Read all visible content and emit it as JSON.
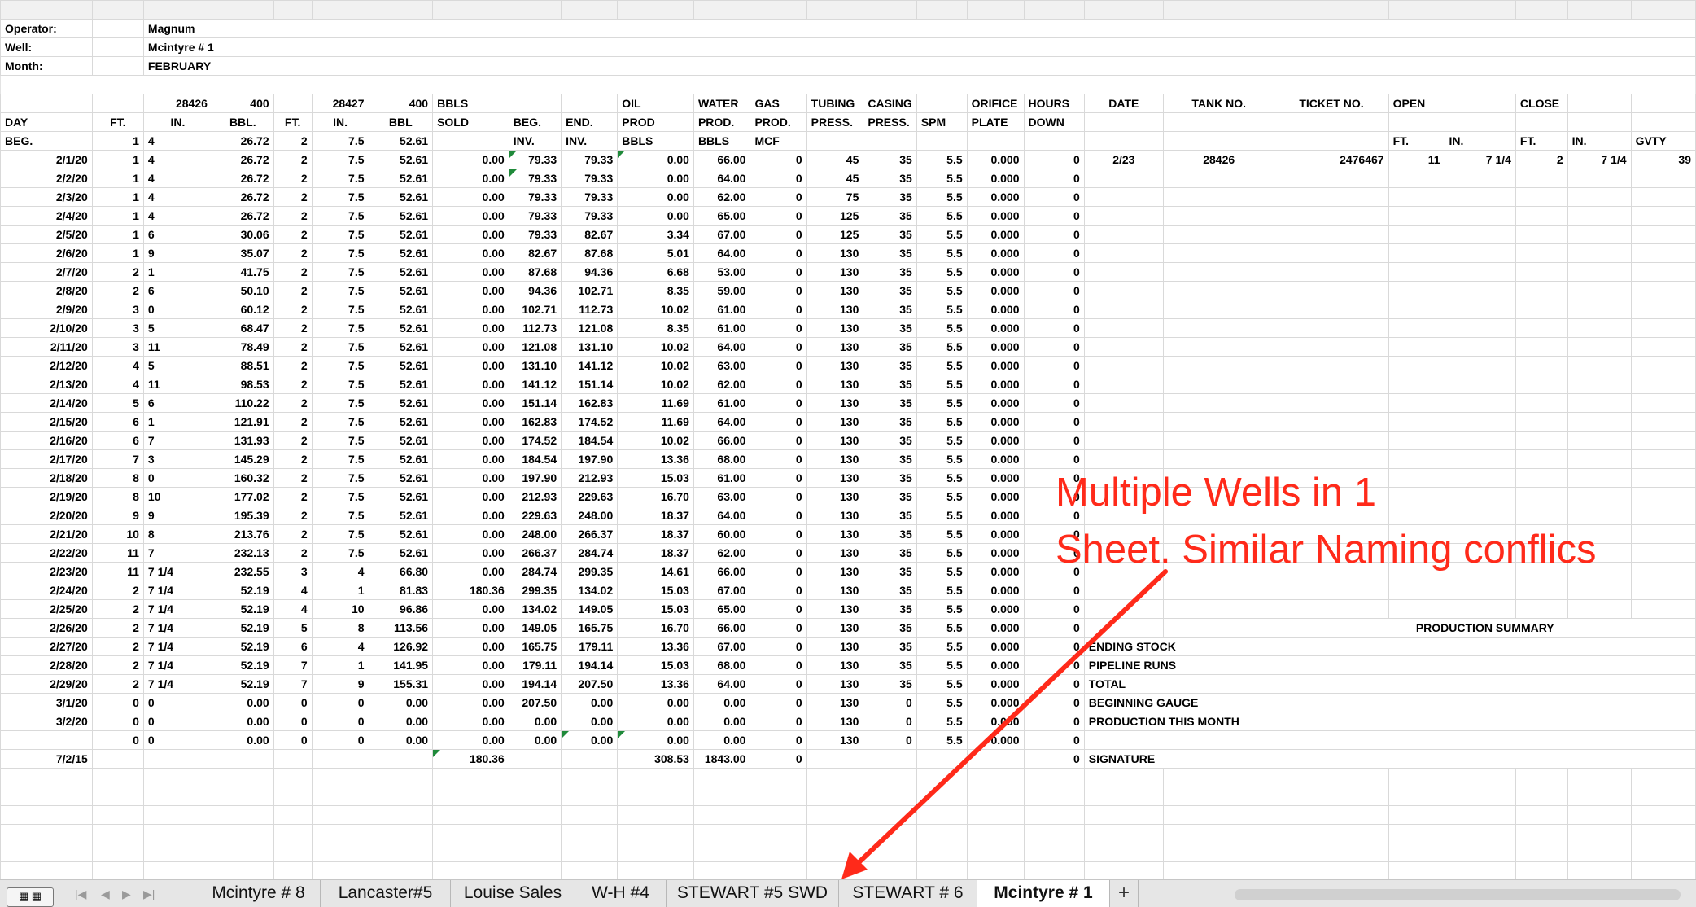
{
  "header": {
    "operator_label": "Operator:",
    "operator": "Magnum",
    "well_label": "Well:",
    "well": "Mcintyre # 1",
    "month_label": "Month:",
    "month": "FEBRUARY"
  },
  "headers": {
    "tank1_no": "28426",
    "tank1_cap": "400",
    "tank2_no": "28427",
    "tank2_cap": "400",
    "bbls": "BBLS",
    "sold": "SOLD",
    "oil": "OIL",
    "prod": "PROD",
    "water": "WATER",
    "prod_dot": "PROD.",
    "gas": "GAS",
    "tubing": "TUBING",
    "casing": "CASING",
    "orifice": "ORIFICE",
    "hours": "HOURS",
    "date": "DATE",
    "tank_no": "TANK NO.",
    "ticket_no": "TICKET NO.",
    "open": "OPEN",
    "close": "CLOSE",
    "day": "DAY",
    "ft": "FT.",
    "in": "IN.",
    "bbl": "BBL.",
    "bbl2": "BBL",
    "beg_dot": "BEG.",
    "end_dot": "END.",
    "press": "PRESS.",
    "spm": "SPM",
    "plate": "PLATE",
    "down": "DOWN",
    "beg": "BEG.",
    "inv": "INV.",
    "bbls_row": "BBLS",
    "mcf": "MCF",
    "gvty": "GVTY"
  },
  "daily_rows": [
    {
      "day": "2/1/20",
      "ft1": "1",
      "in1": "4",
      "bbl1": "26.72",
      "ft2": "2",
      "in2": "7.5",
      "bbl2": "52.61",
      "sold": "0.00",
      "beg_inv": "79.33",
      "end_inv": "79.33",
      "oil": "0.00",
      "water": "66.00",
      "gas": "0",
      "tubing": "45",
      "casing": "35",
      "spm": "5.5",
      "orifice": "0.000",
      "hours": "0"
    },
    {
      "day": "2/2/20",
      "ft1": "1",
      "in1": "4",
      "bbl1": "26.72",
      "ft2": "2",
      "in2": "7.5",
      "bbl2": "52.61",
      "sold": "0.00",
      "beg_inv": "79.33",
      "end_inv": "79.33",
      "oil": "0.00",
      "water": "64.00",
      "gas": "0",
      "tubing": "45",
      "casing": "35",
      "spm": "5.5",
      "orifice": "0.000",
      "hours": "0"
    },
    {
      "day": "2/3/20",
      "ft1": "1",
      "in1": "4",
      "bbl1": "26.72",
      "ft2": "2",
      "in2": "7.5",
      "bbl2": "52.61",
      "sold": "0.00",
      "beg_inv": "79.33",
      "end_inv": "79.33",
      "oil": "0.00",
      "water": "62.00",
      "gas": "0",
      "tubing": "75",
      "casing": "35",
      "spm": "5.5",
      "orifice": "0.000",
      "hours": "0"
    },
    {
      "day": "2/4/20",
      "ft1": "1",
      "in1": "4",
      "bbl1": "26.72",
      "ft2": "2",
      "in2": "7.5",
      "bbl2": "52.61",
      "sold": "0.00",
      "beg_inv": "79.33",
      "end_inv": "79.33",
      "oil": "0.00",
      "water": "65.00",
      "gas": "0",
      "tubing": "125",
      "casing": "35",
      "spm": "5.5",
      "orifice": "0.000",
      "hours": "0"
    },
    {
      "day": "2/5/20",
      "ft1": "1",
      "in1": "6",
      "bbl1": "30.06",
      "ft2": "2",
      "in2": "7.5",
      "bbl2": "52.61",
      "sold": "0.00",
      "beg_inv": "79.33",
      "end_inv": "82.67",
      "oil": "3.34",
      "water": "67.00",
      "gas": "0",
      "tubing": "125",
      "casing": "35",
      "spm": "5.5",
      "orifice": "0.000",
      "hours": "0"
    },
    {
      "day": "2/6/20",
      "ft1": "1",
      "in1": "9",
      "bbl1": "35.07",
      "ft2": "2",
      "in2": "7.5",
      "bbl2": "52.61",
      "sold": "0.00",
      "beg_inv": "82.67",
      "end_inv": "87.68",
      "oil": "5.01",
      "water": "64.00",
      "gas": "0",
      "tubing": "130",
      "casing": "35",
      "spm": "5.5",
      "orifice": "0.000",
      "hours": "0"
    },
    {
      "day": "2/7/20",
      "ft1": "2",
      "in1": "1",
      "bbl1": "41.75",
      "ft2": "2",
      "in2": "7.5",
      "bbl2": "52.61",
      "sold": "0.00",
      "beg_inv": "87.68",
      "end_inv": "94.36",
      "oil": "6.68",
      "water": "53.00",
      "gas": "0",
      "tubing": "130",
      "casing": "35",
      "spm": "5.5",
      "orifice": "0.000",
      "hours": "0"
    },
    {
      "day": "2/8/20",
      "ft1": "2",
      "in1": "6",
      "bbl1": "50.10",
      "ft2": "2",
      "in2": "7.5",
      "bbl2": "52.61",
      "sold": "0.00",
      "beg_inv": "94.36",
      "end_inv": "102.71",
      "oil": "8.35",
      "water": "59.00",
      "gas": "0",
      "tubing": "130",
      "casing": "35",
      "spm": "5.5",
      "orifice": "0.000",
      "hours": "0"
    },
    {
      "day": "2/9/20",
      "ft1": "3",
      "in1": "0",
      "bbl1": "60.12",
      "ft2": "2",
      "in2": "7.5",
      "bbl2": "52.61",
      "sold": "0.00",
      "beg_inv": "102.71",
      "end_inv": "112.73",
      "oil": "10.02",
      "water": "61.00",
      "gas": "0",
      "tubing": "130",
      "casing": "35",
      "spm": "5.5",
      "orifice": "0.000",
      "hours": "0"
    },
    {
      "day": "2/10/20",
      "ft1": "3",
      "in1": "5",
      "bbl1": "68.47",
      "ft2": "2",
      "in2": "7.5",
      "bbl2": "52.61",
      "sold": "0.00",
      "beg_inv": "112.73",
      "end_inv": "121.08",
      "oil": "8.35",
      "water": "61.00",
      "gas": "0",
      "tubing": "130",
      "casing": "35",
      "spm": "5.5",
      "orifice": "0.000",
      "hours": "0"
    },
    {
      "day": "2/11/20",
      "ft1": "3",
      "in1": "11",
      "bbl1": "78.49",
      "ft2": "2",
      "in2": "7.5",
      "bbl2": "52.61",
      "sold": "0.00",
      "beg_inv": "121.08",
      "end_inv": "131.10",
      "oil": "10.02",
      "water": "64.00",
      "gas": "0",
      "tubing": "130",
      "casing": "35",
      "spm": "5.5",
      "orifice": "0.000",
      "hours": "0"
    },
    {
      "day": "2/12/20",
      "ft1": "4",
      "in1": "5",
      "bbl1": "88.51",
      "ft2": "2",
      "in2": "7.5",
      "bbl2": "52.61",
      "sold": "0.00",
      "beg_inv": "131.10",
      "end_inv": "141.12",
      "oil": "10.02",
      "water": "63.00",
      "gas": "0",
      "tubing": "130",
      "casing": "35",
      "spm": "5.5",
      "orifice": "0.000",
      "hours": "0"
    },
    {
      "day": "2/13/20",
      "ft1": "4",
      "in1": "11",
      "bbl1": "98.53",
      "ft2": "2",
      "in2": "7.5",
      "bbl2": "52.61",
      "sold": "0.00",
      "beg_inv": "141.12",
      "end_inv": "151.14",
      "oil": "10.02",
      "water": "62.00",
      "gas": "0",
      "tubing": "130",
      "casing": "35",
      "spm": "5.5",
      "orifice": "0.000",
      "hours": "0"
    },
    {
      "day": "2/14/20",
      "ft1": "5",
      "in1": "6",
      "bbl1": "110.22",
      "ft2": "2",
      "in2": "7.5",
      "bbl2": "52.61",
      "sold": "0.00",
      "beg_inv": "151.14",
      "end_inv": "162.83",
      "oil": "11.69",
      "water": "61.00",
      "gas": "0",
      "tubing": "130",
      "casing": "35",
      "spm": "5.5",
      "orifice": "0.000",
      "hours": "0"
    },
    {
      "day": "2/15/20",
      "ft1": "6",
      "in1": "1",
      "bbl1": "121.91",
      "ft2": "2",
      "in2": "7.5",
      "bbl2": "52.61",
      "sold": "0.00",
      "beg_inv": "162.83",
      "end_inv": "174.52",
      "oil": "11.69",
      "water": "64.00",
      "gas": "0",
      "tubing": "130",
      "casing": "35",
      "spm": "5.5",
      "orifice": "0.000",
      "hours": "0"
    },
    {
      "day": "2/16/20",
      "ft1": "6",
      "in1": "7",
      "bbl1": "131.93",
      "ft2": "2",
      "in2": "7.5",
      "bbl2": "52.61",
      "sold": "0.00",
      "beg_inv": "174.52",
      "end_inv": "184.54",
      "oil": "10.02",
      "water": "66.00",
      "gas": "0",
      "tubing": "130",
      "casing": "35",
      "spm": "5.5",
      "orifice": "0.000",
      "hours": "0"
    },
    {
      "day": "2/17/20",
      "ft1": "7",
      "in1": "3",
      "bbl1": "145.29",
      "ft2": "2",
      "in2": "7.5",
      "bbl2": "52.61",
      "sold": "0.00",
      "beg_inv": "184.54",
      "end_inv": "197.90",
      "oil": "13.36",
      "water": "68.00",
      "gas": "0",
      "tubing": "130",
      "casing": "35",
      "spm": "5.5",
      "orifice": "0.000",
      "hours": "0"
    },
    {
      "day": "2/18/20",
      "ft1": "8",
      "in1": "0",
      "bbl1": "160.32",
      "ft2": "2",
      "in2": "7.5",
      "bbl2": "52.61",
      "sold": "0.00",
      "beg_inv": "197.90",
      "end_inv": "212.93",
      "oil": "15.03",
      "water": "61.00",
      "gas": "0",
      "tubing": "130",
      "casing": "35",
      "spm": "5.5",
      "orifice": "0.000",
      "hours": "0"
    },
    {
      "day": "2/19/20",
      "ft1": "8",
      "in1": "10",
      "bbl1": "177.02",
      "ft2": "2",
      "in2": "7.5",
      "bbl2": "52.61",
      "sold": "0.00",
      "beg_inv": "212.93",
      "end_inv": "229.63",
      "oil": "16.70",
      "water": "63.00",
      "gas": "0",
      "tubing": "130",
      "casing": "35",
      "spm": "5.5",
      "orifice": "0.000",
      "hours": "0"
    },
    {
      "day": "2/20/20",
      "ft1": "9",
      "in1": "9",
      "bbl1": "195.39",
      "ft2": "2",
      "in2": "7.5",
      "bbl2": "52.61",
      "sold": "0.00",
      "beg_inv": "229.63",
      "end_inv": "248.00",
      "oil": "18.37",
      "water": "64.00",
      "gas": "0",
      "tubing": "130",
      "casing": "35",
      "spm": "5.5",
      "orifice": "0.000",
      "hours": "0"
    },
    {
      "day": "2/21/20",
      "ft1": "10",
      "in1": "8",
      "bbl1": "213.76",
      "ft2": "2",
      "in2": "7.5",
      "bbl2": "52.61",
      "sold": "0.00",
      "beg_inv": "248.00",
      "end_inv": "266.37",
      "oil": "18.37",
      "water": "60.00",
      "gas": "0",
      "tubing": "130",
      "casing": "35",
      "spm": "5.5",
      "orifice": "0.000",
      "hours": "0"
    },
    {
      "day": "2/22/20",
      "ft1": "11",
      "in1": "7",
      "bbl1": "232.13",
      "ft2": "2",
      "in2": "7.5",
      "bbl2": "52.61",
      "sold": "0.00",
      "beg_inv": "266.37",
      "end_inv": "284.74",
      "oil": "18.37",
      "water": "62.00",
      "gas": "0",
      "tubing": "130",
      "casing": "35",
      "spm": "5.5",
      "orifice": "0.000",
      "hours": "0"
    },
    {
      "day": "2/23/20",
      "ft1": "11",
      "in1": "7  1/4",
      "bbl1": "232.55",
      "ft2": "3",
      "in2": "4",
      "bbl2": "66.80",
      "sold": "0.00",
      "beg_inv": "284.74",
      "end_inv": "299.35",
      "oil": "14.61",
      "water": "66.00",
      "gas": "0",
      "tubing": "130",
      "casing": "35",
      "spm": "5.5",
      "orifice": "0.000",
      "hours": "0"
    },
    {
      "day": "2/24/20",
      "ft1": "2",
      "in1": "7  1/4",
      "bbl1": "52.19",
      "ft2": "4",
      "in2": "1",
      "bbl2": "81.83",
      "sold": "180.36",
      "beg_inv": "299.35",
      "end_inv": "134.02",
      "oil": "15.03",
      "water": "67.00",
      "gas": "0",
      "tubing": "130",
      "casing": "35",
      "spm": "5.5",
      "orifice": "0.000",
      "hours": "0"
    },
    {
      "day": "2/25/20",
      "ft1": "2",
      "in1": "7  1/4",
      "bbl1": "52.19",
      "ft2": "4",
      "in2": "10",
      "bbl2": "96.86",
      "sold": "0.00",
      "beg_inv": "134.02",
      "end_inv": "149.05",
      "oil": "15.03",
      "water": "65.00",
      "gas": "0",
      "tubing": "130",
      "casing": "35",
      "spm": "5.5",
      "orifice": "0.000",
      "hours": "0"
    },
    {
      "day": "2/26/20",
      "ft1": "2",
      "in1": "7  1/4",
      "bbl1": "52.19",
      "ft2": "5",
      "in2": "8",
      "bbl2": "113.56",
      "sold": "0.00",
      "beg_inv": "149.05",
      "end_inv": "165.75",
      "oil": "16.70",
      "water": "66.00",
      "gas": "0",
      "tubing": "130",
      "casing": "35",
      "spm": "5.5",
      "orifice": "0.000",
      "hours": "0"
    },
    {
      "day": "2/27/20",
      "ft1": "2",
      "in1": "7  1/4",
      "bbl1": "52.19",
      "ft2": "6",
      "in2": "4",
      "bbl2": "126.92",
      "sold": "0.00",
      "beg_inv": "165.75",
      "end_inv": "179.11",
      "oil": "13.36",
      "water": "67.00",
      "gas": "0",
      "tubing": "130",
      "casing": "35",
      "spm": "5.5",
      "orifice": "0.000",
      "hours": "0"
    },
    {
      "day": "2/28/20",
      "ft1": "2",
      "in1": "7  1/4",
      "bbl1": "52.19",
      "ft2": "7",
      "in2": "1",
      "bbl2": "141.95",
      "sold": "0.00",
      "beg_inv": "179.11",
      "end_inv": "194.14",
      "oil": "15.03",
      "water": "68.00",
      "gas": "0",
      "tubing": "130",
      "casing": "35",
      "spm": "5.5",
      "orifice": "0.000",
      "hours": "0"
    },
    {
      "day": "2/29/20",
      "ft1": "2",
      "in1": "7  1/4",
      "bbl1": "52.19",
      "ft2": "7",
      "in2": "9",
      "bbl2": "155.31",
      "sold": "0.00",
      "beg_inv": "194.14",
      "end_inv": "207.50",
      "oil": "13.36",
      "water": "64.00",
      "gas": "0",
      "tubing": "130",
      "casing": "35",
      "spm": "5.5",
      "orifice": "0.000",
      "hours": "0"
    },
    {
      "day": "3/1/20",
      "ft1": "0",
      "in1": "0",
      "bbl1": "0.00",
      "ft2": "0",
      "in2": "0",
      "bbl2": "0.00",
      "sold": "0.00",
      "beg_inv": "207.50",
      "end_inv": "0.00",
      "oil": "0.00",
      "water": "0.00",
      "gas": "0",
      "tubing": "130",
      "casing": "0",
      "spm": "5.5",
      "orifice": "0.000",
      "hours": "0"
    },
    {
      "day": "3/2/20",
      "ft1": "0",
      "in1": "0",
      "bbl1": "0.00",
      "ft2": "0",
      "in2": "0",
      "bbl2": "0.00",
      "sold": "0.00",
      "beg_inv": "0.00",
      "end_inv": "0.00",
      "oil": "0.00",
      "water": "0.00",
      "gas": "0",
      "tubing": "130",
      "casing": "0",
      "spm": "5.5",
      "orifice": "0.000",
      "hours": "0"
    },
    {
      "day": "",
      "ft1": "0",
      "in1": "0",
      "bbl1": "0.00",
      "ft2": "0",
      "in2": "0",
      "bbl2": "0.00",
      "sold": "0.00",
      "beg_inv": "0.00",
      "end_inv": "0.00",
      "oil": "0.00",
      "water": "0.00",
      "gas": "0",
      "tubing": "130",
      "casing": "0",
      "spm": "5.5",
      "orifice": "0.000",
      "hours": "0"
    }
  ],
  "totals": {
    "day": "7/2/15",
    "sold": "180.36",
    "oil": "308.53",
    "water": "1843.00",
    "gas": "0",
    "hours": "0"
  },
  "ticket": {
    "date": "2/23",
    "tank_no": "28426",
    "ticket_no": "2476467",
    "open_ft": "11",
    "open_in": "7  1/4",
    "close_ft": "2",
    "close_in": "7  1/4",
    "gvty": "39"
  },
  "summary": {
    "title": "PRODUCTION SUMMARY",
    "ending_stock": "ENDING STOCK",
    "pipeline_runs": "PIPELINE RUNS",
    "total": "TOTAL",
    "beginning_gauge": "BEGINNING GAUGE",
    "production_this_month": "PRODUCTION THIS MONTH",
    "signature": "SIGNATURE"
  },
  "annotation": {
    "line1": "Multiple Wells in 1",
    "line2": "Sheet.  Similar Naming conflics",
    "color": "#ff2a1a"
  },
  "tabs": [
    "Mcintyre # 8",
    "Lancaster#5",
    "Louise Sales",
    "W-H #4",
    "STEWART #5 SWD",
    "STEWART # 6",
    "Mcintyre # 1"
  ],
  "active_tab": "Mcintyre # 1",
  "add_tab_label": "+"
}
